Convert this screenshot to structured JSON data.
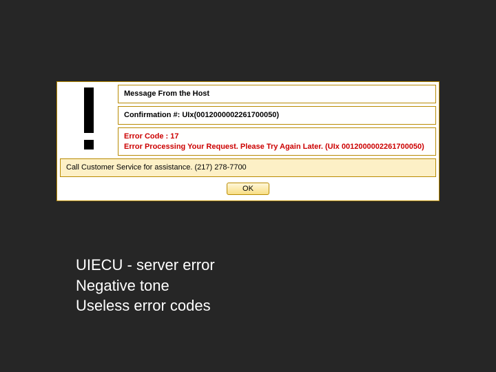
{
  "dialog": {
    "title": "Message From the Host",
    "confirmation_label": "Confirmation #:",
    "confirmation_value": "UIx(0012000002261700050)",
    "error_code_label": "Error Code :",
    "error_code_value": "17",
    "error_message": "Error Processing Your Request. Please Try Again Later. (UIx 0012000002261700050)",
    "footer_message": "Call Customer Service for assistance. (217) 278-7700",
    "ok_label": "OK",
    "icon": "exclamation-icon"
  },
  "caption": {
    "line1": "UIECU - server error",
    "line2": "Negative tone",
    "line3": "Useless error codes"
  }
}
